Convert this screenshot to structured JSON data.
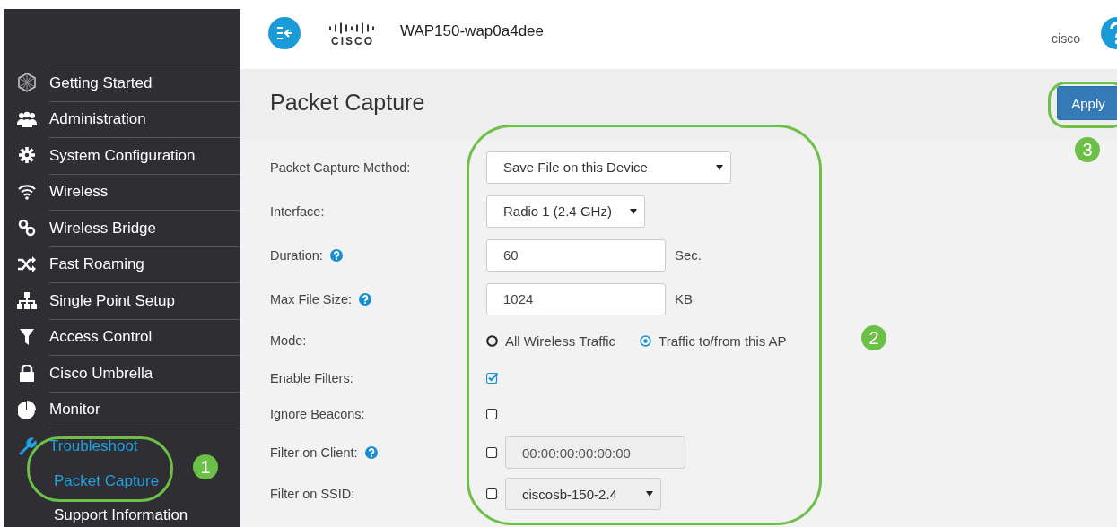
{
  "sidebar": {
    "items": [
      {
        "label": "Getting Started",
        "selected": false
      },
      {
        "label": "Administration",
        "selected": false
      },
      {
        "label": "System Configuration",
        "selected": false
      },
      {
        "label": "Wireless",
        "selected": false
      },
      {
        "label": "Wireless Bridge",
        "selected": false
      },
      {
        "label": "Fast Roaming",
        "selected": false
      },
      {
        "label": "Single Point Setup",
        "selected": false
      },
      {
        "label": "Access Control",
        "selected": false
      },
      {
        "label": "Cisco Umbrella",
        "selected": false
      },
      {
        "label": "Monitor",
        "selected": false
      },
      {
        "label": "Troubleshoot",
        "selected": true,
        "children": [
          {
            "label": "Packet Capture",
            "selected": true
          },
          {
            "label": "Support Information",
            "selected": false
          }
        ]
      }
    ]
  },
  "header": {
    "logo_text": "CISCO",
    "device": "WAP150-wap0a4dee",
    "user": "cisco"
  },
  "page": {
    "title": "Packet Capture",
    "apply": "Apply"
  },
  "form": [
    {
      "kind": "select",
      "label": "Packet Capture Method:",
      "value": "Save File on this Device"
    },
    {
      "kind": "select",
      "label": "Interface:",
      "value": "Radio 1 (2.4 GHz)"
    },
    {
      "kind": "text",
      "label": "Duration:",
      "help": true,
      "value": "60",
      "unit": "Sec."
    },
    {
      "kind": "text",
      "label": "Max File Size:",
      "help": true,
      "value": "1024",
      "unit": "KB"
    },
    {
      "kind": "radio",
      "label": "Mode:",
      "options": [
        {
          "label": "All Wireless Traffic",
          "selected": false
        },
        {
          "label": "Traffic to/from this AP",
          "selected": true
        }
      ]
    },
    {
      "kind": "checkbox",
      "label": "Enable Filters:",
      "checked": true
    },
    {
      "kind": "checkbox",
      "label": "Ignore Beacons:",
      "checked": false
    },
    {
      "kind": "checkbox_text",
      "label": "Filter on Client:",
      "help": true,
      "checked": false,
      "value": "00:00:00:00:00:00",
      "disabled": true
    },
    {
      "kind": "checkbox_select",
      "label": "Filter on SSID:",
      "checked": false,
      "value": "ciscosb-150-2.4",
      "disabled": true
    }
  ],
  "annotations": [
    {
      "label": "1"
    },
    {
      "label": "2"
    },
    {
      "label": "3"
    }
  ]
}
